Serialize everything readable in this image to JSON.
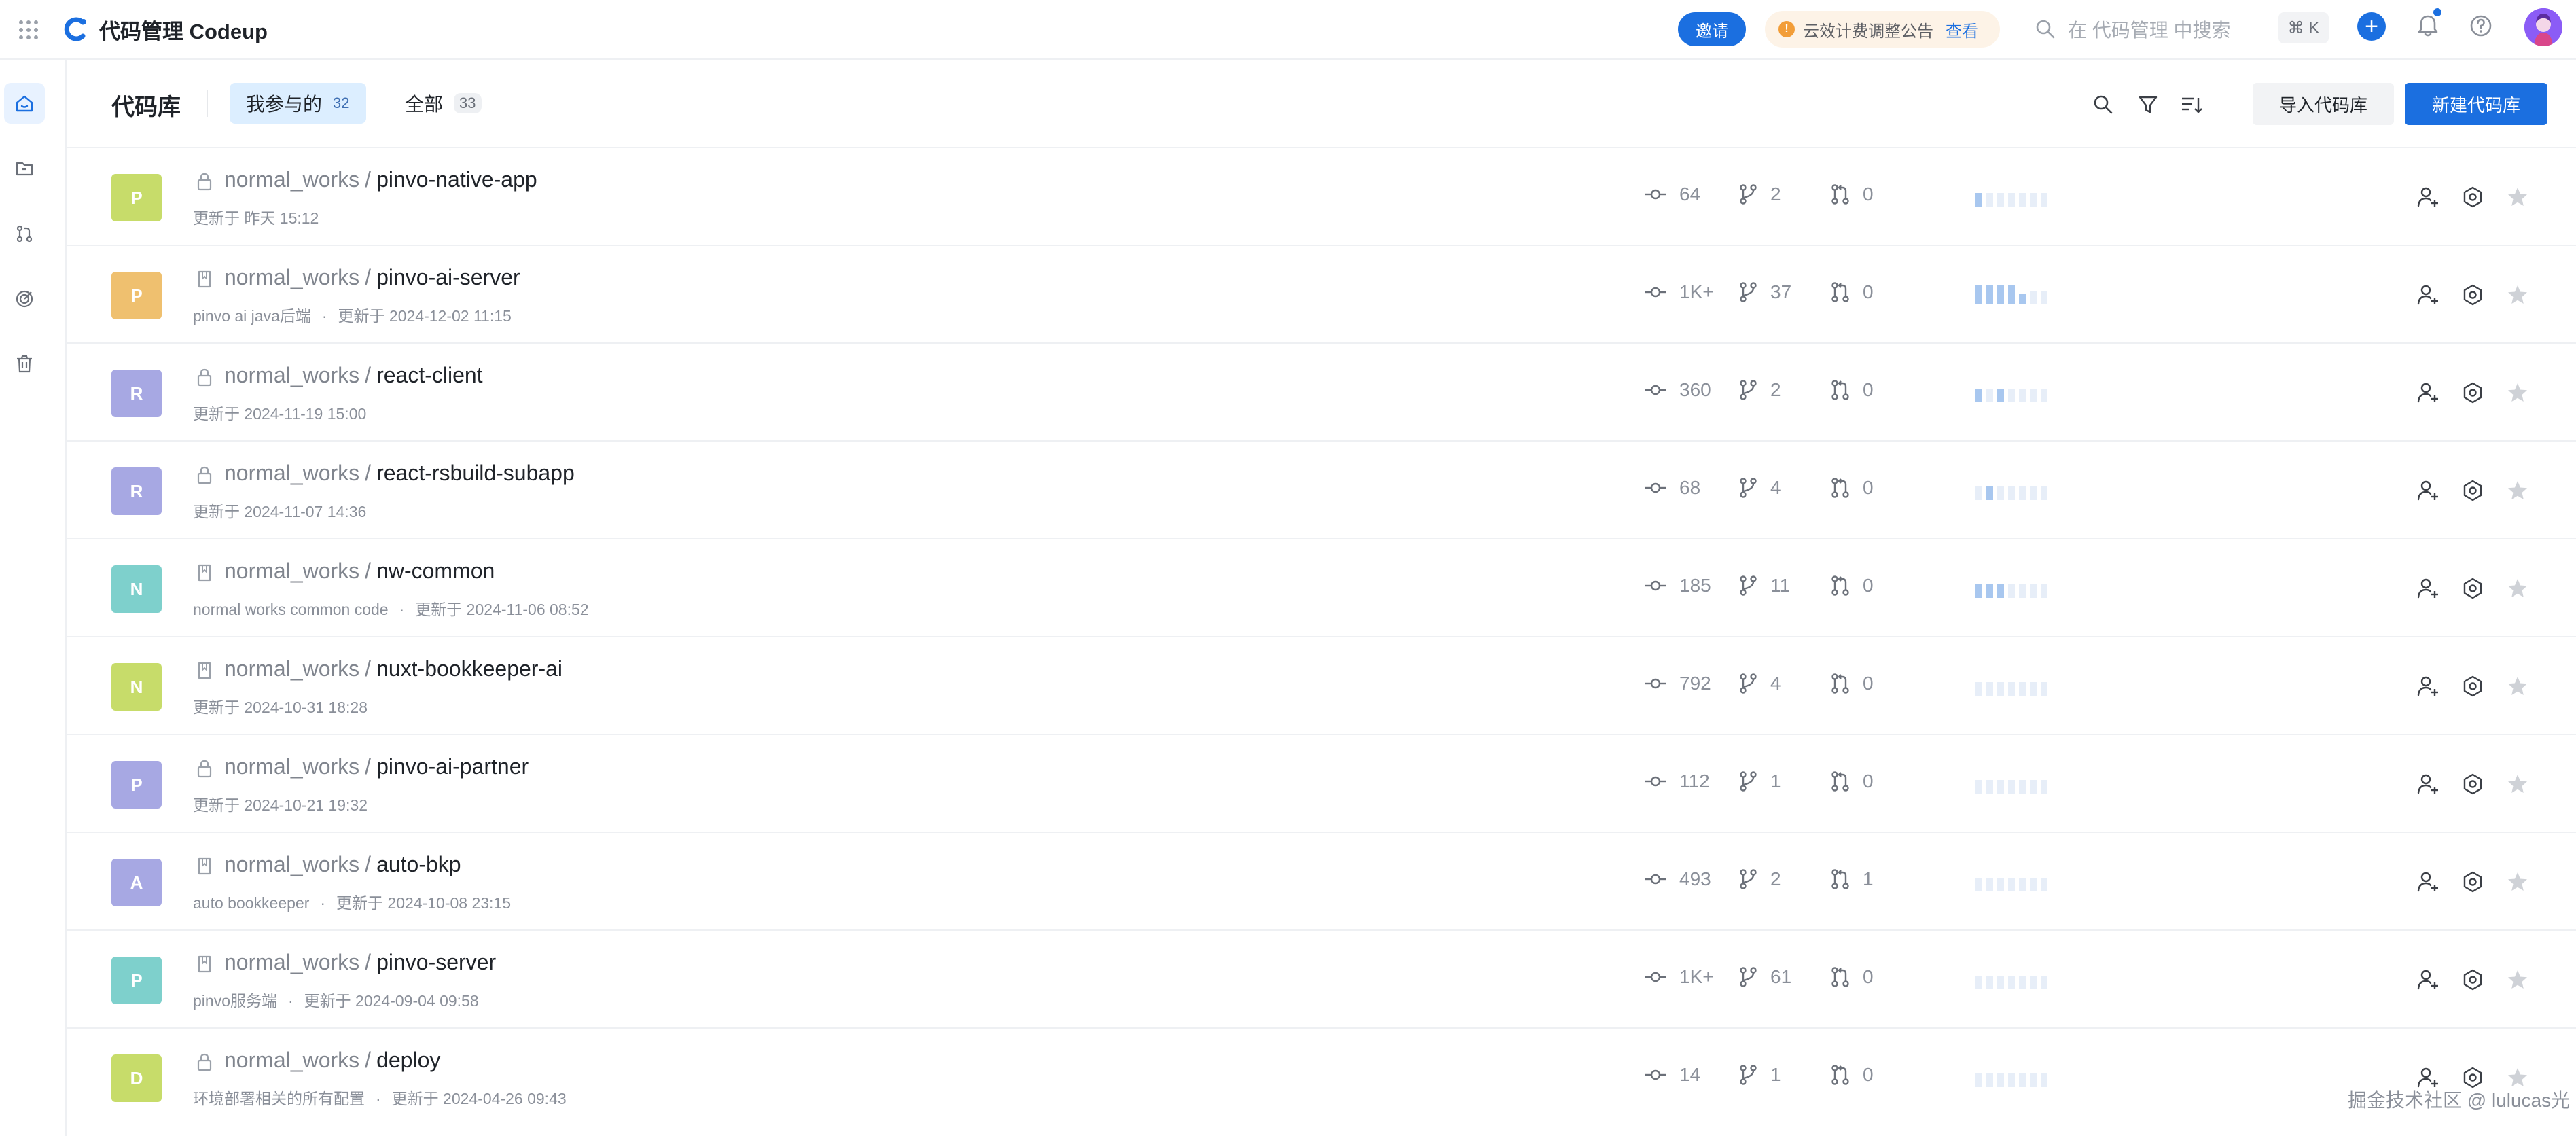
{
  "app": {
    "title": "代码管理 Codeup"
  },
  "topbar": {
    "invite_label": "邀请",
    "notice_text": "云效计费调整公告",
    "notice_link": "查看",
    "search_placeholder": "在 代码管理 中搜索",
    "shortcut": "⌘ K"
  },
  "page": {
    "title": "代码库",
    "tabs": [
      {
        "label": "我参与的",
        "count": "32"
      },
      {
        "label": "全部",
        "count": "33"
      }
    ],
    "import_label": "导入代码库",
    "new_label": "新建代码库"
  },
  "repos": [
    {
      "initial": "P",
      "color": "#c7dc6a",
      "visibility": "private",
      "group": "normal_works",
      "name": "pinvo-native-app",
      "desc": "",
      "updated": "更新于 昨天 15:12",
      "commits": "64",
      "branches": "2",
      "mrs": "0",
      "activity": [
        3,
        1,
        1,
        1,
        1,
        1,
        1
      ]
    },
    {
      "initial": "P",
      "color": "#efc06f",
      "visibility": "internal",
      "group": "normal_works",
      "name": "pinvo-ai-server",
      "desc": "pinvo ai java后端",
      "updated": "更新于 2024-12-02 11:15",
      "commits": "1K+",
      "branches": "37",
      "mrs": "0",
      "activity": [
        5,
        5,
        5,
        5,
        2,
        1,
        1
      ]
    },
    {
      "initial": "R",
      "color": "#a7a8e3",
      "visibility": "private",
      "group": "normal_works",
      "name": "react-client",
      "desc": "",
      "updated": "更新于 2024-11-19 15:00",
      "commits": "360",
      "branches": "2",
      "mrs": "0",
      "activity": [
        3,
        1,
        3,
        1,
        1,
        1,
        1
      ]
    },
    {
      "initial": "R",
      "color": "#a7a8e3",
      "visibility": "private",
      "group": "normal_works",
      "name": "react-rsbuild-subapp",
      "desc": "",
      "updated": "更新于 2024-11-07 14:36",
      "commits": "68",
      "branches": "4",
      "mrs": "0",
      "activity": [
        1,
        3,
        1,
        1,
        1,
        1,
        1
      ]
    },
    {
      "initial": "N",
      "color": "#7ed0cc",
      "visibility": "internal",
      "group": "normal_works",
      "name": "nw-common",
      "desc": "normal works common code",
      "updated": "更新于 2024-11-06 08:52",
      "commits": "185",
      "branches": "11",
      "mrs": "0",
      "activity": [
        3,
        3,
        3,
        1,
        1,
        1,
        1
      ]
    },
    {
      "initial": "N",
      "color": "#c7dc6a",
      "visibility": "internal",
      "group": "normal_works",
      "name": "nuxt-bookkeeper-ai",
      "desc": "",
      "updated": "更新于 2024-10-31 18:28",
      "commits": "792",
      "branches": "4",
      "mrs": "0",
      "activity": [
        1,
        1,
        1,
        1,
        1,
        1,
        1
      ]
    },
    {
      "initial": "P",
      "color": "#a7a8e3",
      "visibility": "private",
      "group": "normal_works",
      "name": "pinvo-ai-partner",
      "desc": "",
      "updated": "更新于 2024-10-21 19:32",
      "commits": "112",
      "branches": "1",
      "mrs": "0",
      "activity": [
        1,
        1,
        1,
        1,
        1,
        1,
        1
      ]
    },
    {
      "initial": "A",
      "color": "#a7a8e3",
      "visibility": "internal",
      "group": "normal_works",
      "name": "auto-bkp",
      "desc": "auto bookkeeper",
      "updated": "更新于 2024-10-08 23:15",
      "commits": "493",
      "branches": "2",
      "mrs": "1",
      "activity": [
        1,
        1,
        1,
        1,
        1,
        1,
        1
      ]
    },
    {
      "initial": "P",
      "color": "#7ed0cc",
      "visibility": "internal",
      "group": "normal_works",
      "name": "pinvo-server",
      "desc": "pinvo服务端",
      "updated": "更新于 2024-09-04 09:58",
      "commits": "1K+",
      "branches": "61",
      "mrs": "0",
      "activity": [
        1,
        1,
        1,
        1,
        1,
        1,
        1
      ]
    },
    {
      "initial": "D",
      "color": "#c7dc6a",
      "visibility": "private",
      "group": "normal_works",
      "name": "deploy",
      "desc": "环境部署相关的所有配置",
      "updated": "更新于 2024-04-26 09:43",
      "commits": "14",
      "branches": "1",
      "mrs": "0",
      "activity": [
        1,
        1,
        1,
        1,
        1,
        1,
        1
      ]
    }
  ],
  "watermark": "掘金技术社区 @ lulucas光"
}
